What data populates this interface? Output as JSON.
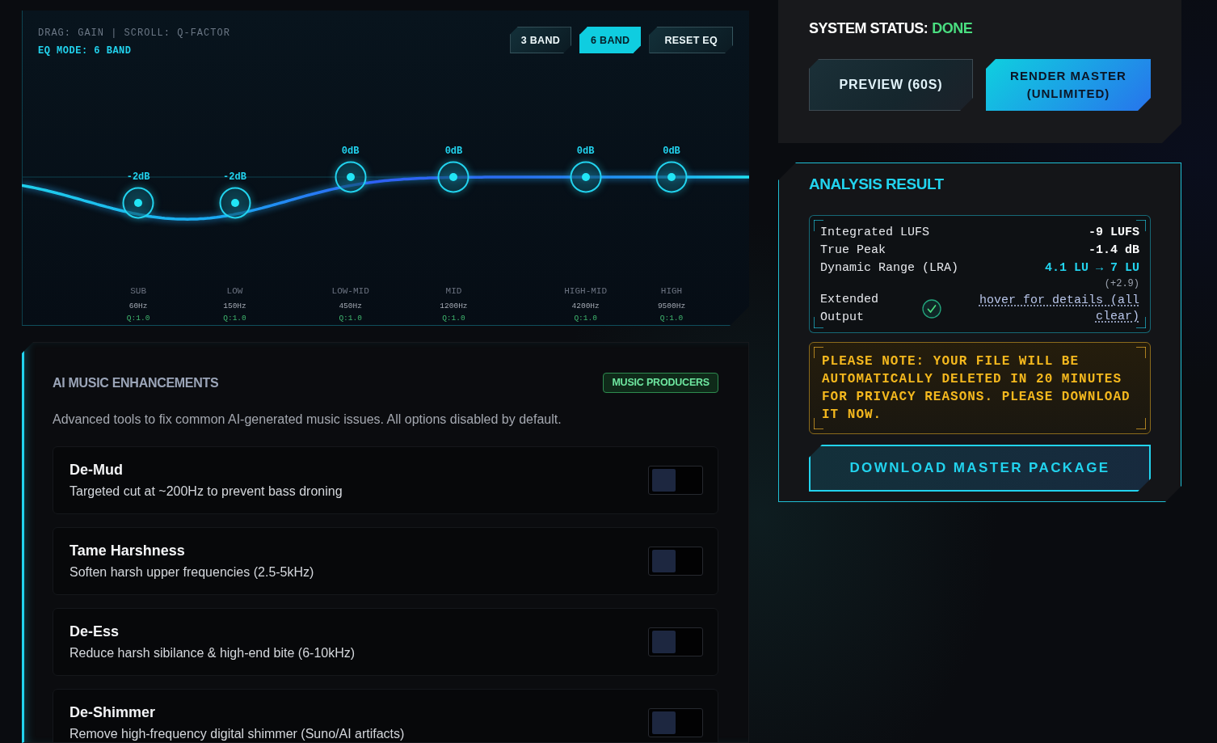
{
  "eq": {
    "hint": "DRAG: GAIN | SCROLL: Q-FACTOR",
    "mode_label": "EQ MODE: 6 BAND",
    "mode_buttons": [
      {
        "label": "3 BAND",
        "selected": false
      },
      {
        "label": "6 BAND",
        "selected": true
      }
    ],
    "reset_button": "RESET EQ",
    "bands": [
      {
        "gain": "-2dB",
        "name": "SUB",
        "frequency": "60Hz",
        "q": "Q:1.0"
      },
      {
        "gain": "-2dB",
        "name": "LOW",
        "frequency": "150Hz",
        "q": "Q:1.0"
      },
      {
        "gain": "0dB",
        "name": "LOW-MID",
        "frequency": "450Hz",
        "q": "Q:1.0"
      },
      {
        "gain": "0dB",
        "name": "MID",
        "frequency": "1200Hz",
        "q": "Q:1.0"
      },
      {
        "gain": "0dB",
        "name": "HIGH-MID",
        "frequency": "4200Hz",
        "q": "Q:1.0"
      },
      {
        "gain": "0dB",
        "name": "HIGH",
        "frequency": "9500Hz",
        "q": "Q:1.0"
      }
    ]
  },
  "enhancements": {
    "title": "AI MUSIC ENHANCEMENTS",
    "badge": "MUSIC PRODUCERS",
    "description": "Advanced tools to fix common AI-generated music issues. All options disabled by default.",
    "options": [
      {
        "title": "De-Mud",
        "description": "Targeted cut at ~200Hz to prevent bass droning",
        "checked": false
      },
      {
        "title": "Tame Harshness",
        "description": "Soften harsh upper frequencies (2.5-5kHz)",
        "checked": false
      },
      {
        "title": "De-Ess",
        "description": "Reduce harsh sibilance & high-end bite (6-10kHz)",
        "checked": false
      },
      {
        "title": "De-Shimmer",
        "description": "Remove high-frequency digital shimmer (Suno/AI artifacts)",
        "checked": false
      }
    ]
  },
  "system_status": {
    "label": "SYSTEM STATUS:",
    "value": "DONE",
    "buttons": [
      {
        "label": "PREVIEW (60S)",
        "kind": "secondary"
      },
      {
        "label": "RENDER MASTER (UNLIMITED)",
        "kind": "primary"
      }
    ]
  },
  "analysis": {
    "title": "ANALYSIS RESULT",
    "metrics": [
      {
        "kind": "value",
        "label": "Integrated LUFS",
        "value": "-9 LUFS"
      },
      {
        "kind": "value",
        "label": "True Peak",
        "value": "-1.4 dB"
      },
      {
        "kind": "change",
        "label": "Dynamic Range (LRA)",
        "value": "4.1 LU → 7 LU",
        "note": "(+2.9)"
      },
      {
        "kind": "status",
        "label": "Extended Output",
        "link": "hover for details (all clear)"
      }
    ],
    "notice": "PLEASE NOTE: YOUR FILE WILL BE AUTOMATICALLY DELETED IN 20 MINUTES FOR PRIVACY REASONS. PLEASE DOWNLOAD IT NOW.",
    "download_button": "DOWNLOAD MASTER PACKAGE"
  }
}
